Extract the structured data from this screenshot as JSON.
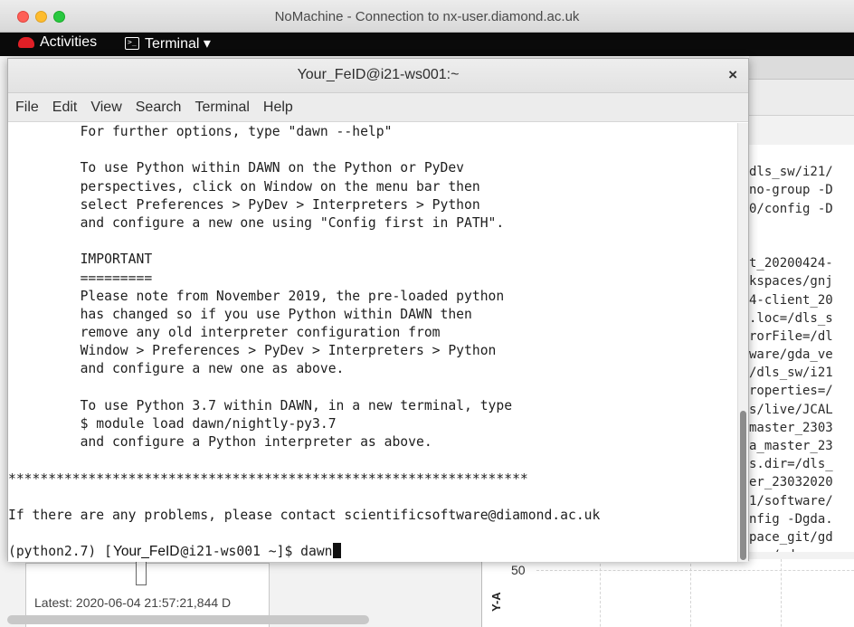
{
  "mac_window": {
    "title": "NoMachine - Connection to nx-user.diamond.ac.uk"
  },
  "gnome_bar": {
    "activities": "Activities",
    "app_menu": "Terminal ▾"
  },
  "terminal": {
    "title": "Your_FeID@i21-ws001:~",
    "close": "×",
    "menu": [
      "File",
      "Edit",
      "View",
      "Search",
      "Terminal",
      "Help"
    ],
    "lines": [
      "         For further options, type \"dawn --help\"",
      "",
      "         To use Python within DAWN on the Python or PyDev",
      "         perspectives, click on Window on the menu bar then",
      "         select Preferences > PyDev > Interpreters > Python",
      "         and configure a new one using \"Config first in PATH\".",
      "",
      "         IMPORTANT",
      "         =========",
      "         Please note from November 2019, the pre-loaded python",
      "         has changed so if you use Python within DAWN then",
      "         remove any old interpreter configuration from",
      "         Window > Preferences > PyDev > Interpreters > Python",
      "         and configure a new one as above.",
      "",
      "         To use Python 3.7 within DAWN, in a new terminal, type",
      "         $ module load dawn/nightly-py3.7",
      "         and configure a Python interpreter as above.",
      "",
      "*****************************************************************",
      "",
      "If there are any problems, please contact scientificsoftware@diamond.ac.uk",
      ""
    ],
    "prompt": {
      "prefix": "(python2.7) [",
      "user": "Your_FeID",
      "host": "@i21-ws001 ~]$ ",
      "command": "dawn"
    }
  },
  "background": {
    "console_lines": [
      "",
      "dls_sw/i21/",
      "no-group -D",
      "0/config -D",
      "",
      "",
      "t_20200424-",
      "kspaces/gnj",
      "4-client_20",
      ".loc=/dls_s",
      "rorFile=/dl",
      "ware/gda_ve",
      "/dls_sw/i21",
      "roperties=/",
      "s/live/JCAL",
      "master_2303",
      "a_master_23",
      "s.dir=/dls_",
      "er_23032020",
      "1/software/",
      "nfig -Dgda.",
      "pace_git/gd",
      "ons/gda_mas"
    ],
    "status": "Latest: 2020-06-04 21:57:21,844 D",
    "plot": {
      "y_axis_label": "Y-A",
      "y_tick": "50"
    }
  }
}
